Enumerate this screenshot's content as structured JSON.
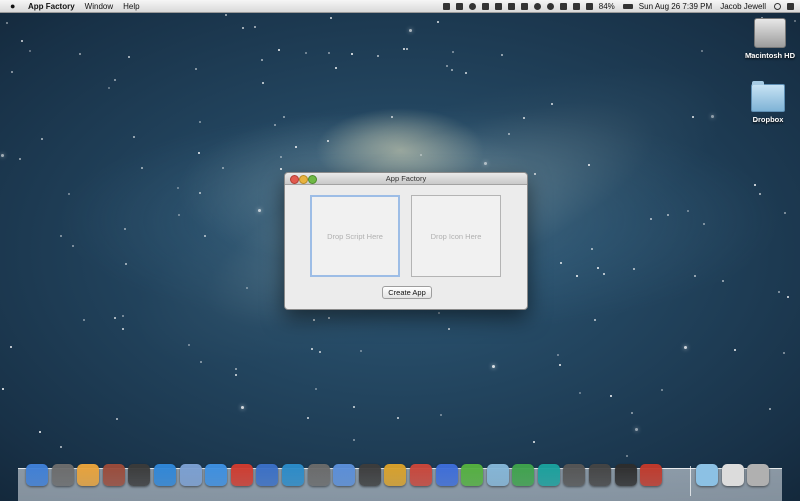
{
  "menubar": {
    "apple_icon": "apple-logo-icon",
    "app_name": "App Factory",
    "menus": [
      "Window",
      "Help"
    ],
    "status_icons": [
      "cat-icon",
      "bag-icon",
      "circle-icon",
      "gamepad-icon",
      "layers-icon",
      "battery-grid-icon",
      "bolt-icon",
      "sync-icon",
      "timemachine-icon",
      "bluetooth-icon",
      "wifi-icon",
      "volume-icon"
    ],
    "battery": "84%",
    "battery_icon": "battery-icon",
    "datetime": "Sun Aug 26  7:39 PM",
    "user": "Jacob Jewell",
    "search_icon": "spotlight-search-icon",
    "list_icon": "notification-list-icon"
  },
  "desktop": {
    "icons": [
      {
        "label": "Macintosh HD",
        "icon": "hard-drive-icon"
      },
      {
        "label": "Dropbox",
        "icon": "folder-icon"
      }
    ]
  },
  "window": {
    "title": "App Factory",
    "script_drop": "Drop Script Here",
    "icon_drop": "Drop Icon Here",
    "create_button": "Create App"
  },
  "dock": {
    "colors": [
      "#3f7fd6",
      "#6c6c6c",
      "#e8a33b",
      "#9a4b3a",
      "#3a3a3a",
      "#2f86d7",
      "#7b9fd1",
      "#3d8fe0",
      "#cf3b2f",
      "#3a6fc5",
      "#2b8bc8",
      "#6a6a6a",
      "#5a8ed8",
      "#3c3c3c",
      "#d8a02a",
      "#c9463a",
      "#3d6dd8",
      "#54b03f",
      "#84b5d6",
      "#3fa24c",
      "#1aa09c",
      "#555555",
      "#444444",
      "#2d2d2d",
      "#c0392b"
    ],
    "right_colors": [
      "#8cc1e4",
      "#dcdcdc",
      "#b0b0b0"
    ]
  }
}
